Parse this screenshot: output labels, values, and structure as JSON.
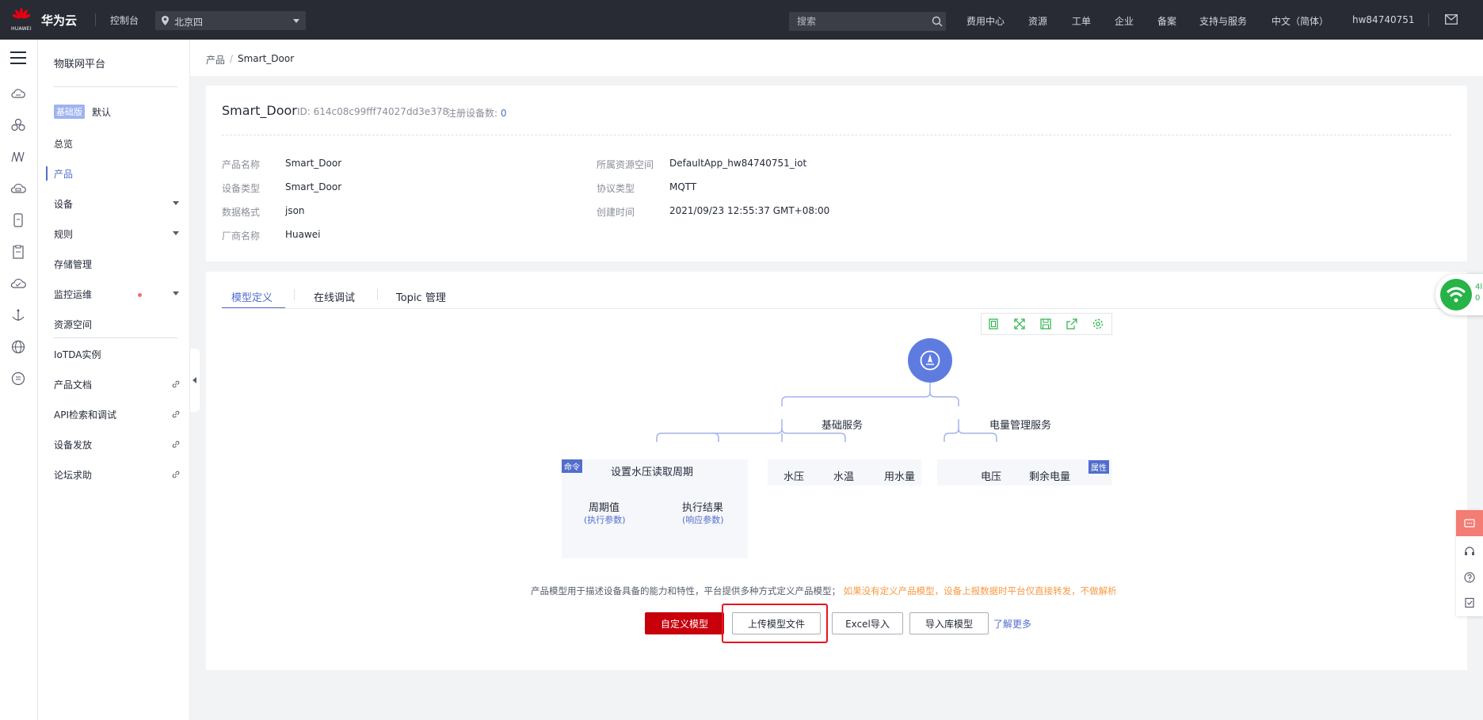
{
  "topbar": {
    "logo_text": "HUAWEI",
    "brand": "华为云",
    "console": "控制台",
    "region": "北京四",
    "search_placeholder": "搜索",
    "nav": [
      "费用中心",
      "资源",
      "工单",
      "企业",
      "备案",
      "支持与服务",
      "中文（简体）",
      "hw84740751"
    ],
    "icons": [
      "location-pin-icon",
      "search-icon",
      "mail-icon"
    ]
  },
  "rail": {
    "icons": [
      "menu-icon",
      "cloud-icon",
      "cluster-icon",
      "chart-icon",
      "cloud-storage-icon",
      "device-icon",
      "document-icon",
      "cloud-check-icon",
      "anchor-icon",
      "globe-icon",
      "circle-doc-icon"
    ]
  },
  "sidenav": {
    "title": "物联网平台",
    "edition_badge": "基础版",
    "edition_name": "默认",
    "items": [
      {
        "label": "总览"
      },
      {
        "label": "产品"
      },
      {
        "label": "设备"
      },
      {
        "label": "规则"
      },
      {
        "label": "存储管理"
      },
      {
        "label": "监控运维"
      },
      {
        "label": "资源空间"
      },
      {
        "label": "IoTDA实例"
      },
      {
        "label": "产品文档"
      },
      {
        "label": "API检索和调试"
      },
      {
        "label": "设备发放"
      },
      {
        "label": "论坛求助"
      }
    ]
  },
  "breadcrumb": {
    "parent": "产品",
    "separator": "/",
    "current": "Smart_Door"
  },
  "product": {
    "name": "Smart_Door",
    "id_label": "ID: 614c08c99fff74027dd3e378",
    "registered_label": "注册设备数:",
    "registered_count": "0",
    "fields": {
      "product_name_label": "产品名称",
      "product_name": "Smart_Door",
      "device_type_label": "设备类型",
      "device_type": "Smart_Door",
      "data_format_label": "数据格式",
      "data_format": "json",
      "vendor_label": "厂商名称",
      "vendor": "Huawei",
      "resource_space_label": "所属资源空间",
      "resource_space": "DefaultApp_hw84740751_iot",
      "protocol_label": "协议类型",
      "protocol": "MQTT",
      "created_label": "创建时间",
      "created": "2021/09/23 12:55:37 GMT+08:00"
    }
  },
  "tabs": [
    "模型定义",
    "在线调试",
    "Topic 管理"
  ],
  "model": {
    "toolbar_icons": [
      "fit-icon",
      "fullscreen-icon",
      "save-icon",
      "export-icon",
      "settings-icon"
    ],
    "services": [
      "基础服务",
      "电量管理服务"
    ],
    "command_tag": "命令",
    "property_tag": "属性",
    "command": "设置水压读取周期",
    "command_params": [
      {
        "name": "周期值",
        "sub": "(执行参数)"
      },
      {
        "name": "执行结果",
        "sub": "(响应参数)"
      }
    ],
    "properties_basic": [
      "水压",
      "水温",
      "用水量"
    ],
    "properties_power": [
      "电压",
      "剩余电量"
    ],
    "description": "产品模型用于描述设备具备的能力和特性，平台提供多种方式定义产品模型；",
    "warning": "如果没有定义产品模型，设备上报数据时平台仅直接转发，不做解析",
    "buttons": {
      "custom": "自定义模型",
      "upload": "上传模型文件",
      "excel": "Excel导入",
      "import_lib": "导入库模型"
    },
    "learn_more": "了解更多"
  },
  "floating": {
    "wifi_text_1": "4l",
    "wifi_text_2": "0"
  },
  "colors": {
    "accent": "#526ecc",
    "primary_button": "#c7000b",
    "warning": "#fa9841",
    "topbar": "#282b33",
    "highlight": "#e8141f"
  }
}
